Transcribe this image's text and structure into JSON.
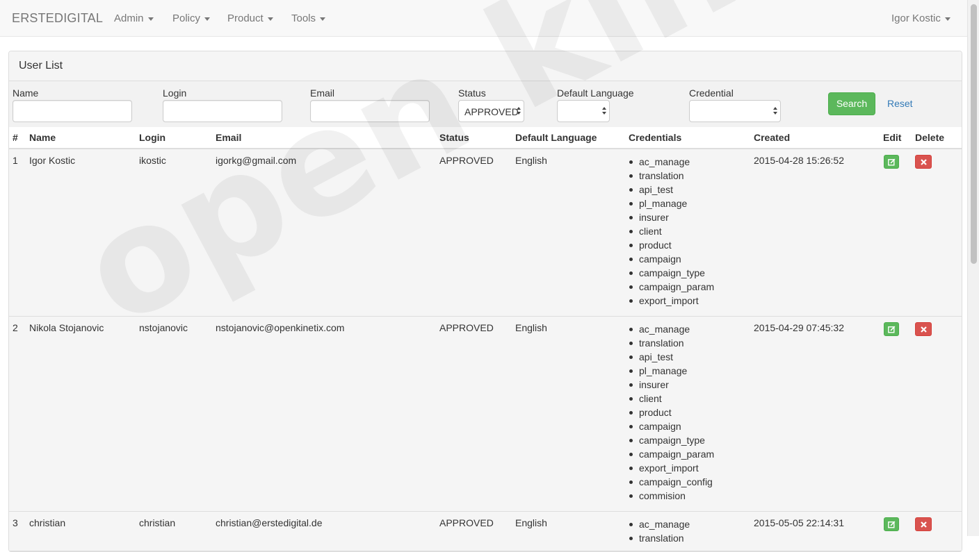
{
  "navbar": {
    "brand": "ERSTEDIGITAL",
    "menus": [
      "Admin",
      "Policy",
      "Product",
      "Tools"
    ],
    "user": "Igor Kostic"
  },
  "panel": {
    "title": "User List"
  },
  "filters": {
    "name_label": "Name",
    "login_label": "Login",
    "email_label": "Email",
    "status_label": "Status",
    "status_value": "APPROVED",
    "language_label": "Default Language",
    "language_value": "",
    "credential_label": "Credential",
    "credential_value": "",
    "search_label": "Search",
    "reset_label": "Reset"
  },
  "table": {
    "headers": [
      "#",
      "Name",
      "Login",
      "Email",
      "Status",
      "Default Language",
      "Credentials",
      "Created",
      "Edit",
      "Delete"
    ],
    "rows": [
      {
        "num": "1",
        "name": "Igor Kostic",
        "login": "ikostic",
        "email": "igorkg@gmail.com",
        "status": "APPROVED",
        "language": "English",
        "created": "2015-04-28 15:26:52",
        "credentials": [
          "ac_manage",
          "translation",
          "api_test",
          "pl_manage",
          "insurer",
          "client",
          "product",
          "campaign",
          "campaign_type",
          "campaign_param",
          "export_import"
        ]
      },
      {
        "num": "2",
        "name": "Nikola Stojanovic",
        "login": "nstojanovic",
        "email": "nstojanovic@openkinetix.com",
        "status": "APPROVED",
        "language": "English",
        "created": "2015-04-29 07:45:32",
        "credentials": [
          "ac_manage",
          "translation",
          "api_test",
          "pl_manage",
          "insurer",
          "client",
          "product",
          "campaign",
          "campaign_type",
          "campaign_param",
          "export_import",
          "campaign_config",
          "commision"
        ]
      },
      {
        "num": "3",
        "name": "christian",
        "login": "christian",
        "email": "christian@erstedigital.de",
        "status": "APPROVED",
        "language": "English",
        "created": "2015-05-05 22:14:31",
        "credentials": [
          "ac_manage",
          "translation"
        ]
      }
    ]
  },
  "colors": {
    "edit": "#5cb85c",
    "delete": "#d9534f",
    "link": "#337ab7"
  },
  "icons": {
    "edit": "edit-icon",
    "delete": "close-icon",
    "caret": "caret-down-icon"
  }
}
